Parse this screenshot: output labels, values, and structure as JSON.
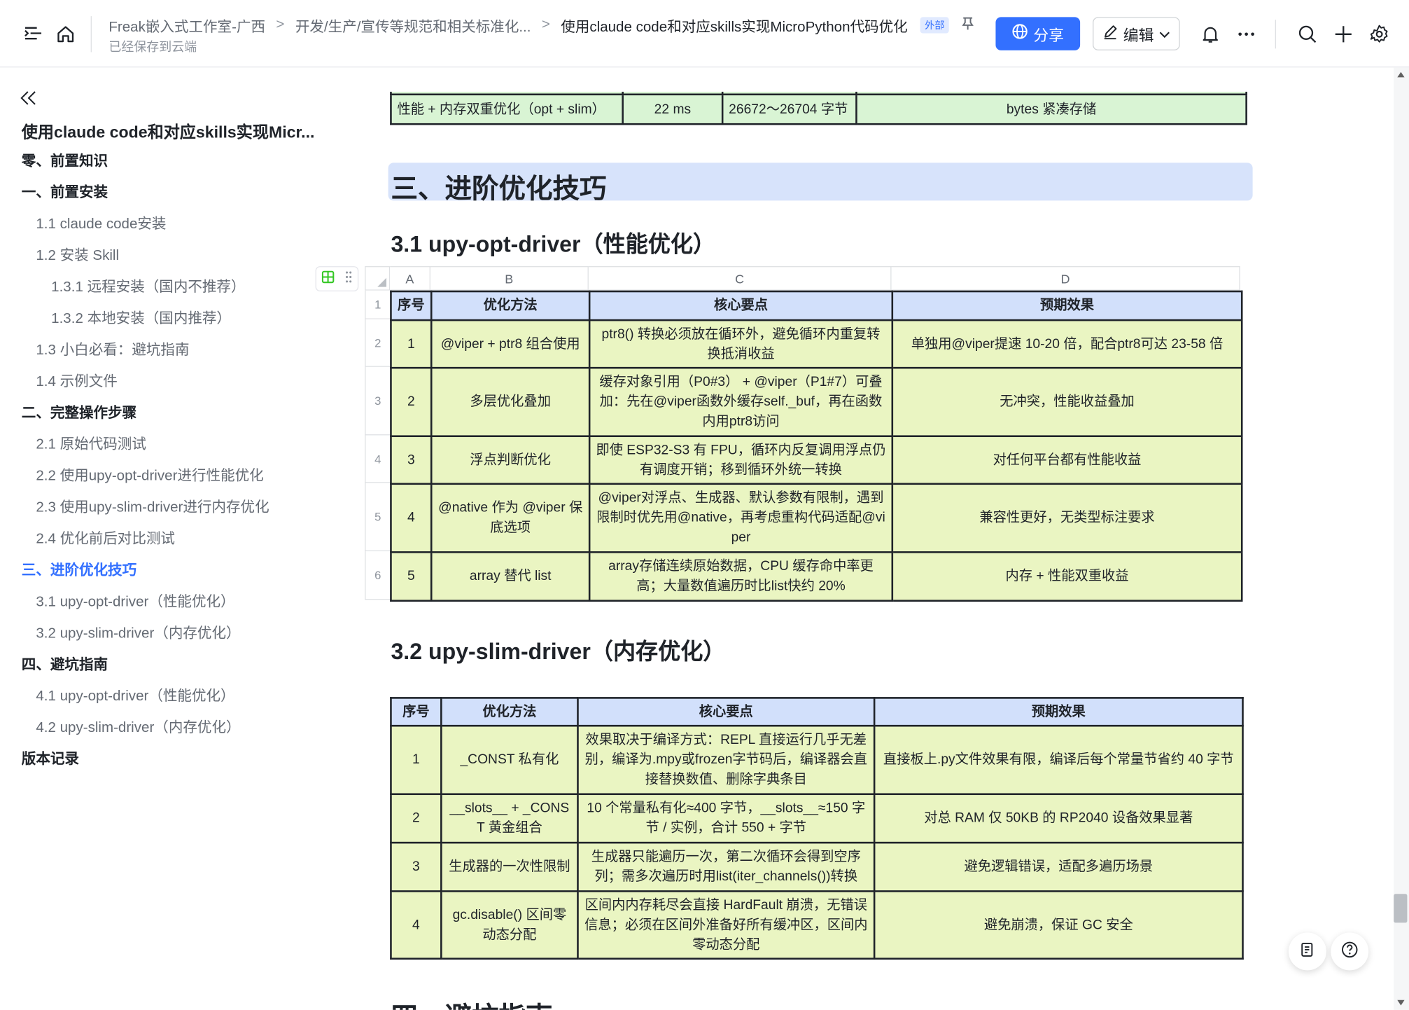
{
  "header": {
    "breadcrumbs": [
      "Freak嵌入式工作室-广西",
      "开发/生产/宣传等规范和相关标准化...",
      "使用claude code和对应skills实现MicroPython代码优化"
    ],
    "external_tag": "外部",
    "saved_status": "已经保存到云端",
    "share_label": "分享",
    "edit_label": "编辑",
    "share_color": "#3370ff"
  },
  "toc": {
    "title": "使用claude code和对应skills实现Micr...",
    "items": [
      {
        "label": "零、前置知识"
      },
      {
        "label": "一、前置安装"
      },
      {
        "label": "1.1 claude code安装"
      },
      {
        "label": "1.2 安装 Skill"
      },
      {
        "label": "1.3.1 远程安装（国内不推荐）"
      },
      {
        "label": "1.3.2 本地安装（国内推荐）"
      },
      {
        "label": "1.3 小白必看：避坑指南"
      },
      {
        "label": "1.4 示例文件"
      },
      {
        "label": "二、完整操作步骤"
      },
      {
        "label": "2.1 原始代码测试"
      },
      {
        "label": "2.2 使用upy-opt-driver进行性能优化"
      },
      {
        "label": "2.3 使用upy-slim-driver进行内存优化"
      },
      {
        "label": "2.4 优化前后对比测试"
      },
      {
        "label": "三、进阶优化技巧"
      },
      {
        "label": "3.1 upy-opt-driver（性能优化）"
      },
      {
        "label": "3.2 upy-slim-driver（内存优化）"
      },
      {
        "label": "四、避坑指南"
      },
      {
        "label": "4.1 upy-opt-driver（性能优化）"
      },
      {
        "label": "4.2 upy-slim-driver（内存优化）"
      },
      {
        "label": "版本记录"
      }
    ]
  },
  "prev_table_row": {
    "method": "性能 + 内存双重优化（opt + slim）",
    "time": "22 ms",
    "memory": "26672～26704 字节",
    "note": "bytes 紧凑存储"
  },
  "section3": {
    "heading": "三、进阶优化技巧",
    "sub1": "3.1 upy-opt-driver（性能优化）",
    "sub2": "3.2 upy-slim-driver（内存优化）"
  },
  "section4_partial": "四、避坑指南",
  "sheet": {
    "columns": [
      "A",
      "B",
      "C",
      "D"
    ],
    "row_numbers": [
      "1",
      "2",
      "3",
      "4",
      "5",
      "6"
    ]
  },
  "table_opt": {
    "headers": [
      "序号",
      "优化方法",
      "核心要点",
      "预期效果"
    ],
    "rows": [
      [
        "1",
        "@viper + ptr8 组合使用",
        "ptr8() 转换必须放在循环外，避免循环内重复转换抵消收益",
        "单独用@viper提速 10-20 倍，配合ptr8可达 23-58 倍"
      ],
      [
        "2",
        "多层优化叠加",
        "缓存对象引用（P0#3） + @viper（P1#7）可叠加：先在@viper函数外缓存self._buf，再在函数内用ptr8访问",
        "无冲突，性能收益叠加"
      ],
      [
        "3",
        "浮点判断优化",
        "即使 ESP32-S3 有 FPU，循环内反复调用浮点仍有调度开销；移到循环外统一转换",
        "对任何平台都有性能收益"
      ],
      [
        "4",
        "@native 作为 @viper 保底选项",
        "@viper对浮点、生成器、默认参数有限制，遇到限制时优先用@native，再考虑重构代码适配@viper",
        "兼容性更好，无类型标注要求"
      ],
      [
        "5",
        "array 替代 list",
        "array存储连续原始数据，CPU 缓存命中率更高；大量数值遍历时比list快约 20%",
        "内存 + 性能双重收益"
      ]
    ]
  },
  "table_slim": {
    "headers": [
      "序号",
      "优化方法",
      "核心要点",
      "预期效果"
    ],
    "rows": [
      [
        "1",
        "_CONST 私有化",
        "效果取决于编译方式：REPL 直接运行几乎无差别，编译为.mpy或frozen字节码后，编译器会直接替换数值、删除字典条目",
        "直接板上.py文件效果有限，编译后每个常量节省约 40 字节"
      ],
      [
        "2",
        "__slots__ + _CONST 黄金组合",
        "10 个常量私有化≈400 字节，__slots__≈150 字节 / 实例，合计 550 + 字节",
        "对总 RAM 仅 50KB 的 RP2040 设备效果显著"
      ],
      [
        "3",
        "生成器的一次性限制",
        "生成器只能遍历一次，第二次循环会得到空序列；需多次遍历时用list(iter_channels())转换",
        "避免逻辑错误，适配多遍历场景"
      ],
      [
        "4",
        "gc.disable() 区间零动态分配",
        "区间内内存耗尽会直接 HardFault 崩溃，无错误信息；必须在区间外准备好所有缓冲区，区间内零动态分配",
        "避免崩溃，保证 GC 安全"
      ]
    ]
  }
}
